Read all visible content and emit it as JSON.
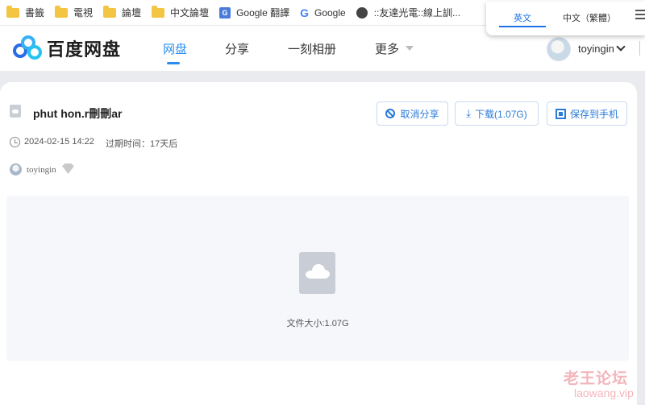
{
  "browser": {
    "bookmarks": [
      {
        "label": "書籤",
        "icon": "folder-icon"
      },
      {
        "label": "電視",
        "icon": "folder-icon"
      },
      {
        "label": "論壇",
        "icon": "folder-icon"
      },
      {
        "label": "中文論壇",
        "icon": "folder-icon"
      },
      {
        "label": "Google 翻譯",
        "icon": "google-translate-icon"
      },
      {
        "label": "Google",
        "icon": "google-icon"
      },
      {
        "label": "::友達光電::線上訓...",
        "icon": "globe-icon"
      }
    ],
    "translate_popup": {
      "option_english": "英文",
      "option_chinese": "中文（繁體）"
    }
  },
  "header": {
    "logo_text": "百度网盘",
    "nav": [
      "网盘",
      "分享",
      "一刻相册",
      "更多"
    ],
    "active_nav": "网盘",
    "username": "toyingin",
    "accent_color": "#2a8ef0"
  },
  "share": {
    "file_name": "phut hon.r刪刪ar",
    "buttons": {
      "cancel_share": "取消分享",
      "download": "下载(1.07G)",
      "save_to_phone": "保存到手机"
    },
    "share_time": "2024-02-15 14:22",
    "expire_text": "过期时间：17天后",
    "sharer_name": "toyingin",
    "file_size_text": "文件大小:1.07G"
  },
  "watermark": {
    "chinese": "老王论坛",
    "english": "laowang.vip"
  }
}
